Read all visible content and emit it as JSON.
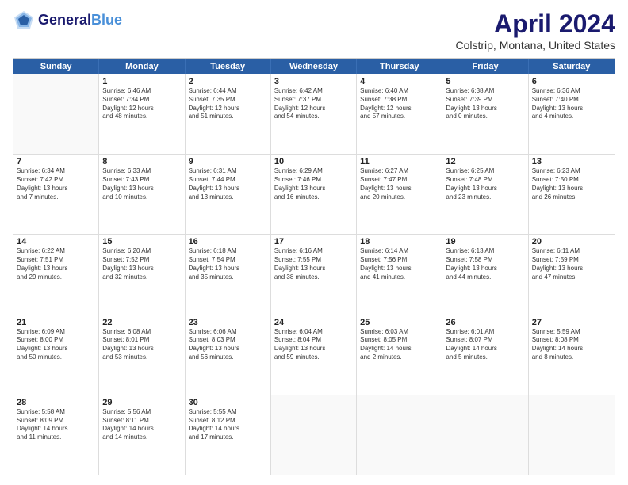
{
  "header": {
    "logo_line1": "General",
    "logo_line2": "Blue",
    "title": "April 2024",
    "subtitle": "Colstrip, Montana, United States"
  },
  "weekdays": [
    "Sunday",
    "Monday",
    "Tuesday",
    "Wednesday",
    "Thursday",
    "Friday",
    "Saturday"
  ],
  "weeks": [
    [
      {
        "num": "",
        "text": ""
      },
      {
        "num": "1",
        "text": "Sunrise: 6:46 AM\nSunset: 7:34 PM\nDaylight: 12 hours\nand 48 minutes."
      },
      {
        "num": "2",
        "text": "Sunrise: 6:44 AM\nSunset: 7:35 PM\nDaylight: 12 hours\nand 51 minutes."
      },
      {
        "num": "3",
        "text": "Sunrise: 6:42 AM\nSunset: 7:37 PM\nDaylight: 12 hours\nand 54 minutes."
      },
      {
        "num": "4",
        "text": "Sunrise: 6:40 AM\nSunset: 7:38 PM\nDaylight: 12 hours\nand 57 minutes."
      },
      {
        "num": "5",
        "text": "Sunrise: 6:38 AM\nSunset: 7:39 PM\nDaylight: 13 hours\nand 0 minutes."
      },
      {
        "num": "6",
        "text": "Sunrise: 6:36 AM\nSunset: 7:40 PM\nDaylight: 13 hours\nand 4 minutes."
      }
    ],
    [
      {
        "num": "7",
        "text": "Sunrise: 6:34 AM\nSunset: 7:42 PM\nDaylight: 13 hours\nand 7 minutes."
      },
      {
        "num": "8",
        "text": "Sunrise: 6:33 AM\nSunset: 7:43 PM\nDaylight: 13 hours\nand 10 minutes."
      },
      {
        "num": "9",
        "text": "Sunrise: 6:31 AM\nSunset: 7:44 PM\nDaylight: 13 hours\nand 13 minutes."
      },
      {
        "num": "10",
        "text": "Sunrise: 6:29 AM\nSunset: 7:46 PM\nDaylight: 13 hours\nand 16 minutes."
      },
      {
        "num": "11",
        "text": "Sunrise: 6:27 AM\nSunset: 7:47 PM\nDaylight: 13 hours\nand 20 minutes."
      },
      {
        "num": "12",
        "text": "Sunrise: 6:25 AM\nSunset: 7:48 PM\nDaylight: 13 hours\nand 23 minutes."
      },
      {
        "num": "13",
        "text": "Sunrise: 6:23 AM\nSunset: 7:50 PM\nDaylight: 13 hours\nand 26 minutes."
      }
    ],
    [
      {
        "num": "14",
        "text": "Sunrise: 6:22 AM\nSunset: 7:51 PM\nDaylight: 13 hours\nand 29 minutes."
      },
      {
        "num": "15",
        "text": "Sunrise: 6:20 AM\nSunset: 7:52 PM\nDaylight: 13 hours\nand 32 minutes."
      },
      {
        "num": "16",
        "text": "Sunrise: 6:18 AM\nSunset: 7:54 PM\nDaylight: 13 hours\nand 35 minutes."
      },
      {
        "num": "17",
        "text": "Sunrise: 6:16 AM\nSunset: 7:55 PM\nDaylight: 13 hours\nand 38 minutes."
      },
      {
        "num": "18",
        "text": "Sunrise: 6:14 AM\nSunset: 7:56 PM\nDaylight: 13 hours\nand 41 minutes."
      },
      {
        "num": "19",
        "text": "Sunrise: 6:13 AM\nSunset: 7:58 PM\nDaylight: 13 hours\nand 44 minutes."
      },
      {
        "num": "20",
        "text": "Sunrise: 6:11 AM\nSunset: 7:59 PM\nDaylight: 13 hours\nand 47 minutes."
      }
    ],
    [
      {
        "num": "21",
        "text": "Sunrise: 6:09 AM\nSunset: 8:00 PM\nDaylight: 13 hours\nand 50 minutes."
      },
      {
        "num": "22",
        "text": "Sunrise: 6:08 AM\nSunset: 8:01 PM\nDaylight: 13 hours\nand 53 minutes."
      },
      {
        "num": "23",
        "text": "Sunrise: 6:06 AM\nSunset: 8:03 PM\nDaylight: 13 hours\nand 56 minutes."
      },
      {
        "num": "24",
        "text": "Sunrise: 6:04 AM\nSunset: 8:04 PM\nDaylight: 13 hours\nand 59 minutes."
      },
      {
        "num": "25",
        "text": "Sunrise: 6:03 AM\nSunset: 8:05 PM\nDaylight: 14 hours\nand 2 minutes."
      },
      {
        "num": "26",
        "text": "Sunrise: 6:01 AM\nSunset: 8:07 PM\nDaylight: 14 hours\nand 5 minutes."
      },
      {
        "num": "27",
        "text": "Sunrise: 5:59 AM\nSunset: 8:08 PM\nDaylight: 14 hours\nand 8 minutes."
      }
    ],
    [
      {
        "num": "28",
        "text": "Sunrise: 5:58 AM\nSunset: 8:09 PM\nDaylight: 14 hours\nand 11 minutes."
      },
      {
        "num": "29",
        "text": "Sunrise: 5:56 AM\nSunset: 8:11 PM\nDaylight: 14 hours\nand 14 minutes."
      },
      {
        "num": "30",
        "text": "Sunrise: 5:55 AM\nSunset: 8:12 PM\nDaylight: 14 hours\nand 17 minutes."
      },
      {
        "num": "",
        "text": ""
      },
      {
        "num": "",
        "text": ""
      },
      {
        "num": "",
        "text": ""
      },
      {
        "num": "",
        "text": ""
      }
    ]
  ]
}
